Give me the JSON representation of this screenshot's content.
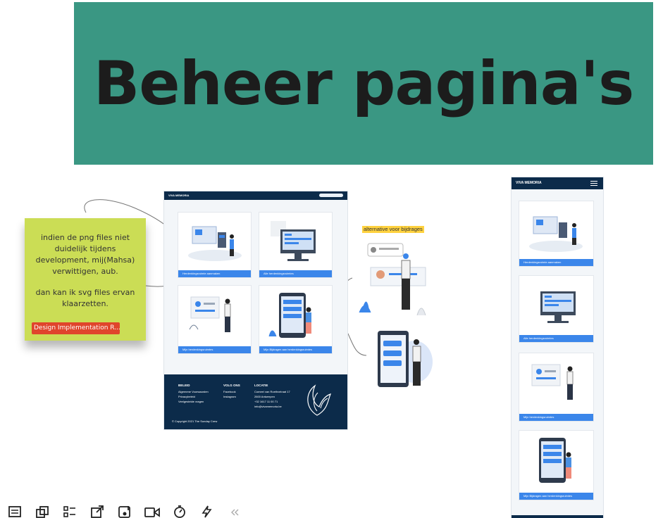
{
  "banner": {
    "title": "Beheer pagina's"
  },
  "sticky": {
    "text_part1": "indien de png files niet duidelijk tijdens development, mij(Mahsa) verwittigen, aub.",
    "text_part2": "dan kan ik svg files ervan klaarzetten.",
    "tag": "Design Implementation R..."
  },
  "alt_label": "alternative voor bijdrages",
  "desktop": {
    "brand": "VIVA MEMORIA",
    "cards": [
      "Herdenkingsruimte aanmaken",
      "Alle herdenkingsruimtes",
      "Mijn herdenkingsruimtes",
      "Mijn Bijdragen aan herdenkingsruimtes"
    ],
    "footer": {
      "col1_title": "BELEID",
      "col1_items": [
        "Algemene Voorwaarden",
        "Privacybeleid",
        "Veelgestelde vragen"
      ],
      "col2_title": "VOLG ONS",
      "col2_items": [
        "Facebook",
        "Instagram"
      ],
      "col3_title": "LOCATIE",
      "col3_items": [
        "Comeel van Roethvelraat 17",
        "2600 Antwerpen",
        "+32 1617 11 00 71",
        "info@vivamemoria.be"
      ],
      "copyright": "© Copyright 2021 The Sunday Crew"
    }
  },
  "mobile": {
    "brand": "VIVA MEMORIA",
    "cards": [
      "Herdenkingsruimte aanmaken",
      "Alle herdenkingsruimtes",
      "Mijn herdenkingsruimtes",
      "Mijn Bijdragen aan herdenkingsruimtes"
    ]
  },
  "toolbar": {
    "items": [
      "list-icon",
      "frames-icon",
      "checklist-icon",
      "export-icon",
      "insert-icon",
      "video-icon",
      "timer-icon",
      "lightning-icon",
      "collapse-icon"
    ]
  },
  "colors": {
    "banner": "#3a9783",
    "sticky": "#cbdd55",
    "tag": "#e0452c",
    "navy": "#0c2b4a",
    "accent_blue": "#3b86ea",
    "highlight": "#ffd23f"
  }
}
